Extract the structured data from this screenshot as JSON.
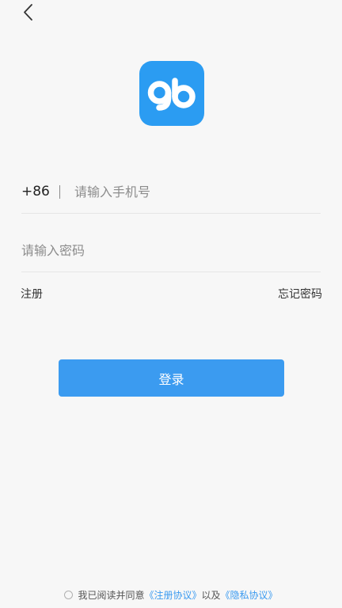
{
  "header": {
    "back_icon": "chevron-left-icon"
  },
  "logo": {
    "text": "gb",
    "background": "#2b9cf2"
  },
  "phone_field": {
    "country_code": "+86",
    "placeholder": "请输入手机号",
    "value": ""
  },
  "password_field": {
    "placeholder": "请输入密码",
    "value": ""
  },
  "links": {
    "register": "注册",
    "forgot_password": "忘记密码"
  },
  "login_button": {
    "label": "登录",
    "color": "#3b9bf0"
  },
  "agreement": {
    "prefix": "我已阅读并同意",
    "register_agreement": "《注册协议》",
    "conjunction": "以及",
    "privacy_agreement": "《隐私协议》",
    "checked": false
  }
}
